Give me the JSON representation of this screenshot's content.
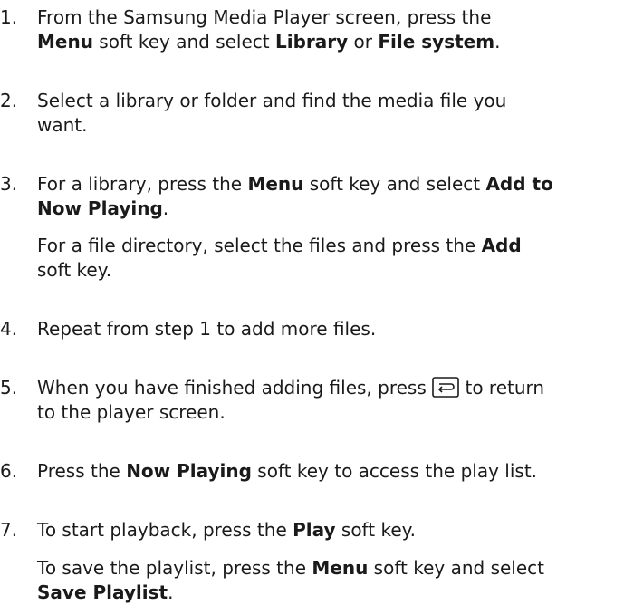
{
  "steps": [
    {
      "number": "1.",
      "l1a": "From the Samsung Media Player screen, press the",
      "l2_menu": "Menu",
      "l2_mid": " soft key and select ",
      "l2_library": "Library",
      "l2_or": " or ",
      "l2_filesystem": "File system",
      "l2_end": "."
    },
    {
      "number": "2.",
      "l1": "Select a library or folder and find the media file you",
      "l2": "want."
    },
    {
      "number": "3.",
      "l1a": "For a library, press the ",
      "l1_menu": "Menu",
      "l1b": " soft key and select ",
      "l1_addto": "Add to",
      "l2_nowplaying": "Now Playing",
      "l2_end": ".",
      "p1a": "For a file directory, select the files and press the ",
      "p1_add": "Add",
      "p2": "soft key."
    },
    {
      "number": "4.",
      "l1": "Repeat from step 1 to add more files."
    },
    {
      "number": "5.",
      "l1a": "When you have finished adding files, press ",
      "l1b": " to return",
      "l2": "to the player screen.",
      "icon": "back-key-icon"
    },
    {
      "number": "6.",
      "l1a": "Press the ",
      "l1_nowplaying": "Now Playing",
      "l1b": " soft key to access the play list."
    },
    {
      "number": "7.",
      "l1a": "To start playback, press the ",
      "l1_play": "Play",
      "l1b": " soft key.",
      "p1a": "To save the playlist, press  the ",
      "p1_menu": "Menu",
      "p1b": " soft key and select",
      "p2_saveplaylist": "Save Playlist",
      "p2_end": "."
    }
  ]
}
